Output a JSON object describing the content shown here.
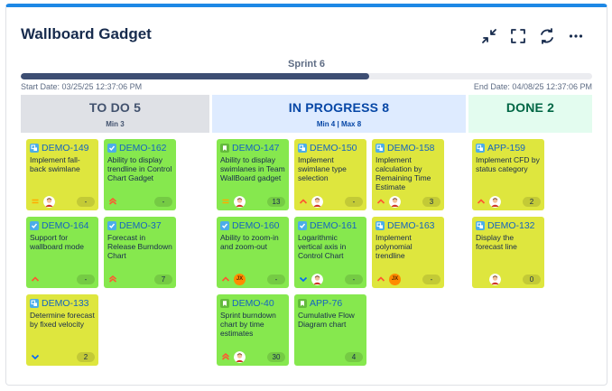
{
  "gadget": {
    "title": "Wallboard Gadget"
  },
  "toolbar": {
    "icons": [
      "collapse-icon",
      "fullscreen-icon",
      "refresh-icon",
      "more-icon"
    ]
  },
  "sprint": {
    "name": "Sprint 6",
    "progress": 0.61,
    "start": "Start Date: 03/25/25 12:37:06 PM",
    "end": "End Date: 04/08/25 12:37:06 PM"
  },
  "columns": {
    "todo": {
      "title": "TO DO 5",
      "sub": "Min 3",
      "bg": "#dfe1e6",
      "color": "#42526e"
    },
    "inprogress": {
      "title": "IN PROGRESS 8",
      "sub": "Min 4 | Max 8",
      "bg": "#deebff",
      "color": "#0747a6"
    },
    "done": {
      "title": "DONE 2",
      "sub": "",
      "bg": "#e3fcef",
      "color": "#006644"
    }
  },
  "colors": {
    "yellow_card": "#dee63e",
    "green_card": "#86e84e",
    "key_link": "#1565c0"
  },
  "cards": [
    {
      "key": "DEMO-149",
      "summary": "Implement fall-back swimlane",
      "type": "subtask",
      "priority": "medium",
      "avatar": "person",
      "estimate": "-",
      "color": "yellow"
    },
    {
      "key": "DEMO-162",
      "summary": "Ability to display trendline in Control Chart Gadget",
      "type": "task",
      "priority": "highest",
      "avatar": "none",
      "estimate": "-",
      "color": "green"
    },
    {
      "key": "DEMO-164",
      "summary": "Support for wallboard mode",
      "type": "task",
      "priority": "high",
      "avatar": "none",
      "estimate": "-",
      "color": "green"
    },
    {
      "key": "DEMO-37",
      "summary": "Forecast in Release Burndown Chart",
      "type": "task",
      "priority": "highest",
      "avatar": "none",
      "estimate": "7",
      "color": "green"
    },
    {
      "key": "DEMO-133",
      "summary": "Determine forecast by fixed velocity",
      "type": "subtask",
      "priority": "low",
      "avatar": "none",
      "estimate": "2",
      "color": "yellow"
    },
    {
      "key": "DEMO-147",
      "summary": "Ability to display swimlanes in Team WallBoard gadget",
      "type": "story",
      "priority": "medium",
      "avatar": "person",
      "estimate": "13",
      "color": "green"
    },
    {
      "key": "DEMO-150",
      "summary": "Implement swimlane type selection",
      "type": "subtask",
      "priority": "high",
      "avatar": "person",
      "estimate": "-",
      "color": "yellow"
    },
    {
      "key": "DEMO-158",
      "summary": "Implement calculation by Remaining Time Estimate",
      "type": "subtask",
      "priority": "high",
      "avatar": "person",
      "estimate": "3",
      "color": "yellow"
    },
    {
      "key": "DEMO-160",
      "summary": "Ability to zoom-in and zoom-out",
      "type": "task",
      "priority": "high",
      "avatar": "jx",
      "estimate": "-",
      "color": "green"
    },
    {
      "key": "DEMO-161",
      "summary": "Logarithmic vertical axis in Control Chart",
      "type": "task",
      "priority": "low",
      "avatar": "person",
      "estimate": "-",
      "color": "green"
    },
    {
      "key": "DEMO-163",
      "summary": "Implement polynomial trendline",
      "type": "subtask",
      "priority": "high",
      "avatar": "jx",
      "estimate": "-",
      "color": "yellow"
    },
    {
      "key": "DEMO-40",
      "summary": "Sprint burndown chart by time estimates",
      "type": "story",
      "priority": "highest",
      "avatar": "person",
      "estimate": "30",
      "color": "green"
    },
    {
      "key": "APP-76",
      "summary": "Cumulative Flow Diagram chart",
      "type": "story",
      "priority": "none",
      "avatar": "none",
      "estimate": "4",
      "color": "green"
    },
    {
      "key": "APP-159",
      "summary": "Implement CFD by status category",
      "type": "subtask",
      "priority": "high",
      "avatar": "person",
      "estimate": "2",
      "color": "yellow"
    },
    {
      "key": "DEMO-132",
      "summary": "Display the forecast line",
      "type": "subtask",
      "priority": "none",
      "avatar": "person",
      "estimate": "0",
      "color": "yellow"
    }
  ],
  "avatar_initials": "JX"
}
